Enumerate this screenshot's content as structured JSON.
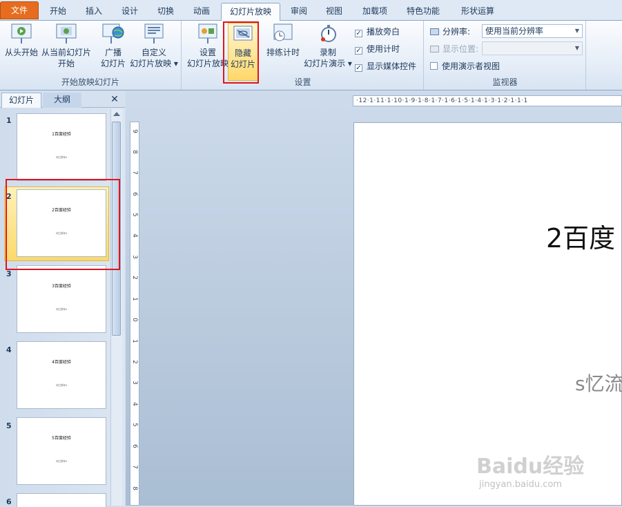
{
  "tabs": [
    {
      "label": "文件",
      "kind": "file"
    },
    {
      "label": "开始"
    },
    {
      "label": "插入"
    },
    {
      "label": "设计"
    },
    {
      "label": "切换"
    },
    {
      "label": "动画"
    },
    {
      "label": "幻灯片放映",
      "kind": "active"
    },
    {
      "label": "审阅"
    },
    {
      "label": "视图"
    },
    {
      "label": "加载项"
    },
    {
      "label": "特色功能"
    },
    {
      "label": "形状运算"
    }
  ],
  "ribbon": {
    "group_start": {
      "label": "开始放映幻灯片",
      "from_start": "从头开始",
      "from_current_1": "从当前幻灯片",
      "from_current_2": "开始",
      "broadcast_1": "广播",
      "broadcast_2": "幻灯片",
      "custom_1": "自定义",
      "custom_2": "幻灯片放映 ▾"
    },
    "group_setup": {
      "label": "设置",
      "setup_1": "设置",
      "setup_2": "幻灯片放映",
      "hide_1": "隐藏",
      "hide_2": "幻灯片",
      "rehearse": "排练计时",
      "record_1": "录制",
      "record_2": "幻灯片演示 ▾",
      "play_narration": "播放旁白",
      "use_timings": "使用计时",
      "show_media": "显示媒体控件",
      "check_mark": "✓"
    },
    "group_monitor": {
      "label": "监视器",
      "resolution_label": "分辨率:",
      "resolution_value": "使用当前分辨率",
      "position_label": "显示位置:",
      "presenter_view": "使用演示者视图"
    }
  },
  "panel": {
    "tab_slides": "幻灯片",
    "tab_outline": "大纲",
    "close": "✕",
    "slides": [
      {
        "num": "1",
        "title": "1百度经验",
        "sub": "s忆流年s"
      },
      {
        "num": "2",
        "title": "2百度经验",
        "sub": "s忆流年s"
      },
      {
        "num": "3",
        "title": "3百度经验",
        "sub": "s忆流年s"
      },
      {
        "num": "4",
        "title": "4百度经验",
        "sub": "s忆流年s"
      },
      {
        "num": "5",
        "title": "5百度经验",
        "sub": "s忆流年s"
      },
      {
        "num": "6",
        "title": "",
        "sub": ""
      }
    ]
  },
  "ruler_h": "·12·1·11·1·10·1·9·1·8·1·7·1·6·1·5·1·4·1·3·1·2·1·1·1",
  "ruler_v": [
    "9",
    "8",
    "7",
    "6",
    "5",
    "4",
    "3",
    "2",
    "1",
    "0",
    "1",
    "2",
    "3",
    "4",
    "5",
    "6",
    "7",
    "8"
  ],
  "slide": {
    "title": "2百度",
    "subtitle": "s忆流"
  },
  "watermark": {
    "brand": "Baidu经验",
    "url": "jingyan.baidu.com"
  },
  "colors": {
    "accent_file": "#e66d1f",
    "highlight_red": "#e0141e",
    "selected_thumb": "#fbd96b"
  }
}
